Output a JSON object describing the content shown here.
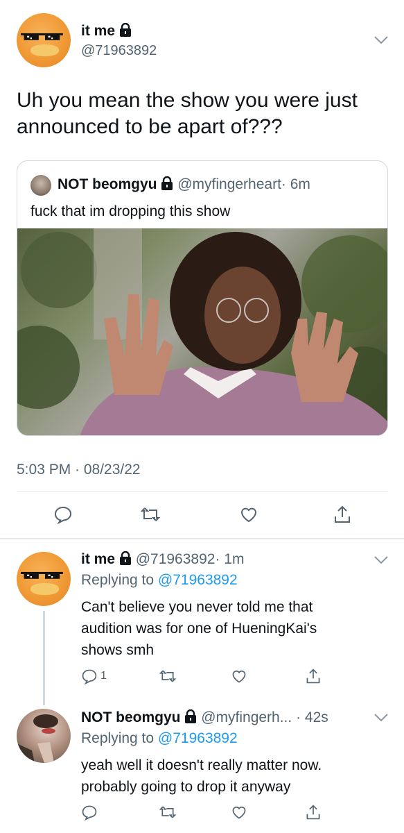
{
  "main_tweet": {
    "display_name": "it me",
    "handle": "@71963892",
    "text_line1": "Uh you mean the show you were just",
    "text_line2": "announced to be apart of???",
    "timestamp": "5:03 PM · 08/23/22",
    "quoted": {
      "display_name": "NOT beomgyu",
      "handle": "@myfingerheart",
      "time": "· 6m",
      "text": "fuck that im dropping this show"
    }
  },
  "replies": [
    {
      "display_name": "it me",
      "handle": "@71963892",
      "time": "· 1m",
      "replying_prefix": "Replying to",
      "replying_to": "@71963892",
      "text_line1": "Can't believe you never told me that",
      "text_line2": "audition was for one of HueningKai's",
      "text_line3": "shows smh",
      "reply_count": "1"
    },
    {
      "display_name": "NOT beomgyu",
      "handle": "@myfingerh...",
      "time": "· 42s",
      "replying_prefix": "Replying to",
      "replying_to": "@71963892",
      "text_line1": "yeah well it doesn't really matter now.",
      "text_line2": "probably going to drop it anyway"
    }
  ],
  "colors": {
    "accent": "#1d9bf0",
    "muted": "#536471",
    "border": "#cfd9de"
  }
}
